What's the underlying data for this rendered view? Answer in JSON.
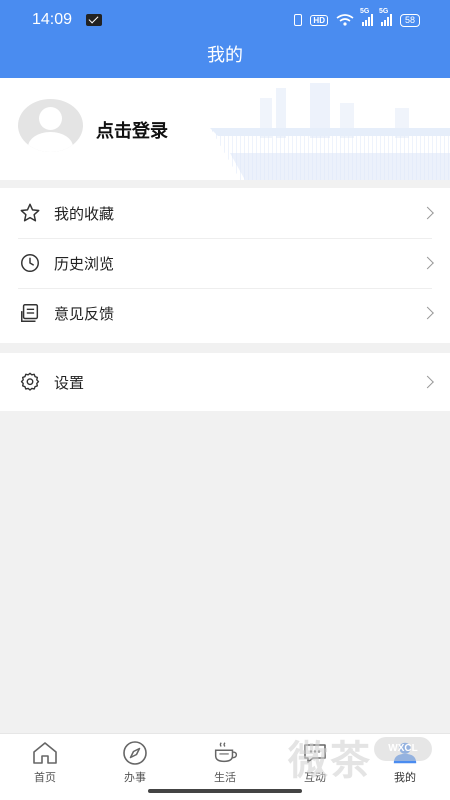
{
  "status_bar": {
    "time": "14:09",
    "network_hd": "HD",
    "network_5g_1": "5G",
    "network_5g_2": "5G",
    "battery": "58"
  },
  "header": {
    "title": "我的"
  },
  "profile": {
    "login_text": "点击登录"
  },
  "menu": {
    "items": [
      {
        "label": "我的收藏",
        "icon": "star-icon"
      },
      {
        "label": "历史浏览",
        "icon": "clock-icon"
      },
      {
        "label": "意见反馈",
        "icon": "feedback-icon"
      }
    ],
    "settings": {
      "label": "设置",
      "icon": "gear-icon"
    }
  },
  "tabs": [
    {
      "label": "首页",
      "icon": "home-icon"
    },
    {
      "label": "办事",
      "icon": "compass-icon"
    },
    {
      "label": "生活",
      "icon": "coffee-icon"
    },
    {
      "label": "互动",
      "icon": "chat-icon"
    },
    {
      "label": "我的",
      "icon": "user-icon",
      "active": true
    }
  ],
  "watermark": {
    "text": "微茶",
    "badge": "WXCL"
  },
  "colors": {
    "brand": "#4a8cf0",
    "background": "#f1f1f1"
  }
}
